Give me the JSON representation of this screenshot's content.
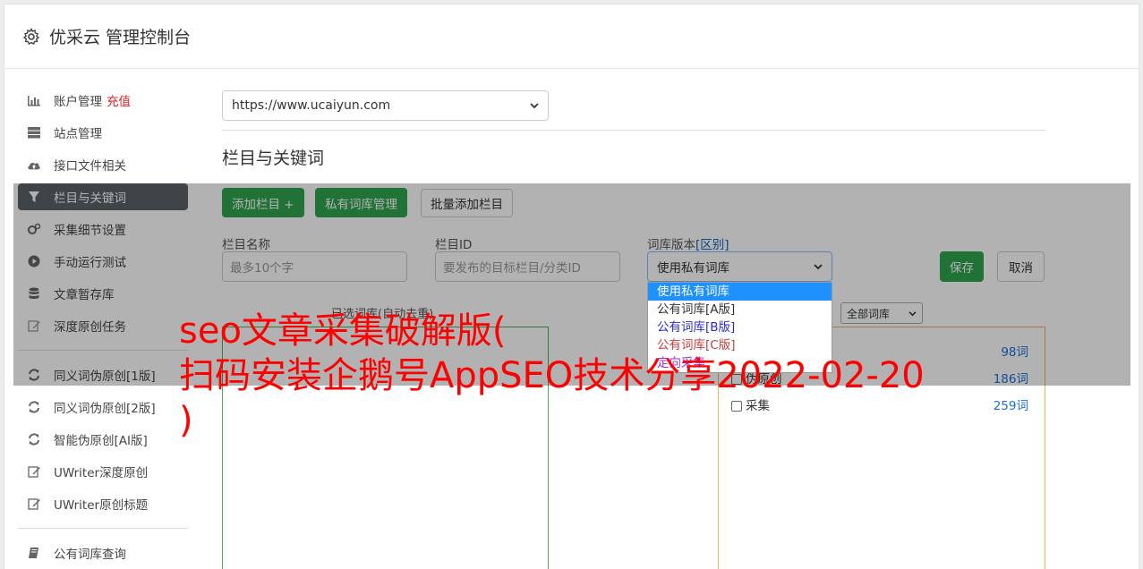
{
  "header": {
    "title": "优采云 管理控制台",
    "icon": "gear-icon"
  },
  "sidebar": {
    "group1": [
      {
        "label": "账户管理",
        "badge": "充值",
        "icon": "bar-chart-icon"
      },
      {
        "label": "站点管理",
        "icon": "server-icon"
      },
      {
        "label": "接口文件相关",
        "icon": "cloud-upload-icon"
      },
      {
        "label": "栏目与关键词",
        "icon": "filter-icon",
        "active": true
      },
      {
        "label": "采集细节设置",
        "icon": "cogs-icon"
      },
      {
        "label": "手动运行测试",
        "icon": "play-circle-icon"
      },
      {
        "label": "文章暂存库",
        "icon": "database-icon"
      },
      {
        "label": "深度原创任务",
        "icon": "edit-icon"
      }
    ],
    "group2": [
      {
        "label": "同义词伪原创[1版]",
        "icon": "refresh-icon"
      },
      {
        "label": "同义词伪原创[2版]",
        "icon": "refresh-icon"
      },
      {
        "label": "智能伪原创[AI版]",
        "icon": "refresh-icon"
      },
      {
        "label": "UWriter深度原创",
        "icon": "edit-icon"
      },
      {
        "label": "UWriter原创标题",
        "icon": "edit-icon"
      }
    ],
    "group3": [
      {
        "label": "公有词库查询",
        "icon": "book-icon"
      }
    ]
  },
  "main": {
    "site_select": "https://www.ucaiyun.com",
    "section_title": "栏目与关键词",
    "buttons": {
      "add_column": "添加栏目 +",
      "private_lib": "私有词库管理",
      "batch_add": "批量添加栏目",
      "save": "保存",
      "cancel": "取消"
    },
    "fields": {
      "column_name_label": "栏目名称",
      "column_name_placeholder": "最多10个字",
      "column_id_label": "栏目ID",
      "column_id_placeholder": "要发布的目标栏目/分类ID",
      "lib_version_label": "词库版本",
      "lib_version_link": "[区别]",
      "lib_version_value": "使用私有词库"
    },
    "dropdown_options": [
      "使用私有词库",
      "公有词库[A版]",
      "公有词库[B版]",
      "公有词库[C版]",
      "定向采集"
    ],
    "selected_words_label": "已选词库(自动去重)",
    "all_libs_select": "全部词库",
    "library_rows": [
      {
        "name": "伪原创",
        "count": "186词"
      },
      {
        "name": "采集",
        "count": "259词"
      }
    ],
    "first_row_count": "98词"
  },
  "watermark": {
    "line1": "seo文章采集破解版(",
    "line2": "扫码安装企鹅号AppSEO技术分享2022-02-20",
    "line3": ")"
  }
}
